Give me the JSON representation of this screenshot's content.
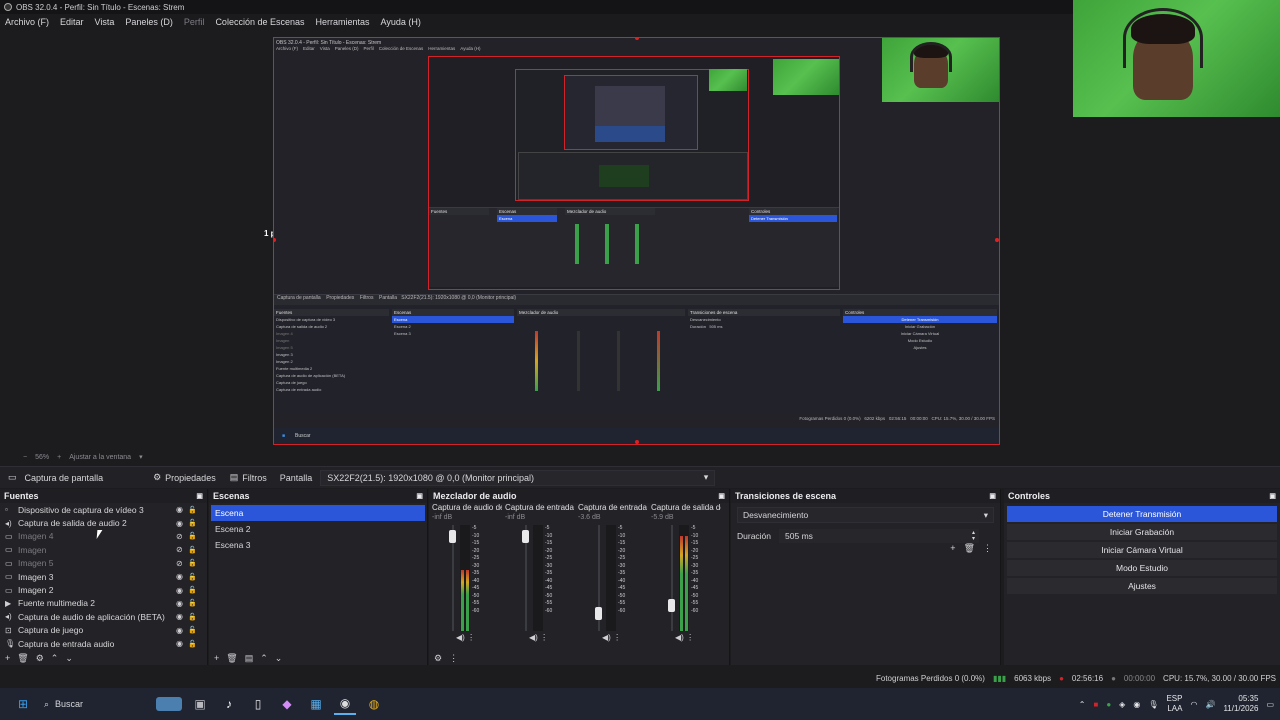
{
  "window": {
    "title": "OBS 32.0.4 - Perfil: Sin Título - Escenas: Strem"
  },
  "menu": [
    {
      "label": "Archivo (F)",
      "dim": false
    },
    {
      "label": "Editar",
      "dim": false
    },
    {
      "label": "Vista",
      "dim": false
    },
    {
      "label": "Paneles (D)",
      "dim": false
    },
    {
      "label": "Perfil",
      "dim": true
    },
    {
      "label": "Colección de Escenas",
      "dim": false
    },
    {
      "label": "Herramientas",
      "dim": false
    },
    {
      "label": "Ayuda (H)",
      "dim": false
    }
  ],
  "preview": {
    "px_label": "1 px",
    "zoom": "56%",
    "fit_label": "Ajustar a la ventana"
  },
  "context_bar": {
    "source_name": "Captura de pantalla",
    "properties": "Propiedades",
    "filters": "Filtros",
    "screen_label": "Pantalla",
    "monitor": "SX22F2(21.5): 1920x1080 @ 0,0 (Monitor principal)"
  },
  "sources": {
    "title": "Fuentes",
    "items": [
      {
        "name": "Dispositivo de captura de vídeo 3",
        "icon": "camera",
        "dimmed": false,
        "visible": true
      },
      {
        "name": "Captura de salida de audio 2",
        "icon": "speaker",
        "dimmed": false,
        "visible": true
      },
      {
        "name": "Imagen 4",
        "icon": "image",
        "dimmed": true,
        "visible": false
      },
      {
        "name": "Imagen",
        "icon": "image",
        "dimmed": true,
        "visible": false
      },
      {
        "name": "Imagen 5",
        "icon": "image",
        "dimmed": true,
        "visible": false
      },
      {
        "name": "Imagen 3",
        "icon": "image",
        "dimmed": false,
        "visible": true
      },
      {
        "name": "Imagen 2",
        "icon": "image",
        "dimmed": false,
        "visible": true
      },
      {
        "name": "Fuente multimedia 2",
        "icon": "play",
        "dimmed": false,
        "visible": true
      },
      {
        "name": "Captura de audio de aplicación (BETA)",
        "icon": "speaker",
        "dimmed": false,
        "visible": true
      },
      {
        "name": "Captura de juego",
        "icon": "gamepad",
        "dimmed": false,
        "visible": true
      },
      {
        "name": "Captura de entrada audio",
        "icon": "mic",
        "dimmed": false,
        "visible": true
      }
    ]
  },
  "scenes": {
    "title": "Escenas",
    "items": [
      {
        "name": "Escena",
        "selected": true
      },
      {
        "name": "Escena 2",
        "selected": false
      },
      {
        "name": "Escena 3",
        "selected": false
      }
    ]
  },
  "mixer": {
    "title": "Mezclador de audio",
    "channels": [
      {
        "name": "Captura de audio de",
        "db": "-inf dB",
        "level": 0.58,
        "fader": 0.95,
        "color_top": "#c0392b"
      },
      {
        "name": "Captura de entrada",
        "db": "-inf dB",
        "level": 0.0,
        "fader": 0.95,
        "color_top": "#c0392b"
      },
      {
        "name": "Captura de entrada",
        "db": "-3.6 dB",
        "level": 0.0,
        "fader": 0.12,
        "color_top": "#2b56d9"
      },
      {
        "name": "Captura de salida de",
        "db": "-5.9 dB",
        "level": 0.9,
        "fader": 0.2,
        "color_top": "#c0392b"
      }
    ]
  },
  "transitions": {
    "title": "Transiciones de escena",
    "selected": "Desvanecimiento",
    "duration_label": "Duración",
    "duration_value": "505 ms"
  },
  "controls": {
    "title": "Controles",
    "buttons": [
      {
        "label": "Detener Transmisión",
        "active": true
      },
      {
        "label": "Iniciar Grabación",
        "active": false
      },
      {
        "label": "Iniciar Cámara Virtual",
        "active": false
      },
      {
        "label": "Modo Estudio",
        "active": false
      },
      {
        "label": "Ajustes",
        "active": false
      }
    ]
  },
  "status": {
    "dropped": "Fotogramas Perdidos 0 (0.0%)",
    "kbps": "6063 kbps",
    "stream_time": "02:56:16",
    "rec_time": "00:00:00",
    "cpu": "CPU: 15.7%, 30.00 / 30.00 FPS"
  },
  "taskbar": {
    "search": "Buscar",
    "lang_1": "ESP",
    "lang_2": "LAA",
    "time": "05:35",
    "date": "11/1/2026"
  }
}
